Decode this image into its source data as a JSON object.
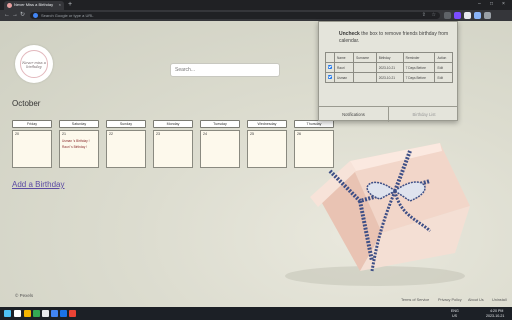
{
  "browser": {
    "tab_title": "Never Miss a Birthday",
    "tab_close": "×",
    "new_tab": "+",
    "omnibox_placeholder": "Search Google or type a URL",
    "back": "←",
    "forward": "→",
    "reload": "↻",
    "minimize": "–",
    "maximize": "□",
    "close": "×",
    "share": "⇪",
    "star": "☆",
    "extension_icon_colors": [
      "#5f6368",
      "#7c4dff",
      "#e8eaed",
      "#8ab4f8",
      "#9aa0a6"
    ]
  },
  "page": {
    "logo_text": "Never miss a birthday",
    "search_placeholder": "Search...",
    "month": "October",
    "days": [
      {
        "label": "Friday",
        "num": "20",
        "events": []
      },
      {
        "label": "Saturday",
        "num": "21",
        "events": [
          "Usman 's Birthday !",
          "Rauri 's Birthday !"
        ]
      },
      {
        "label": "Sunday",
        "num": "22",
        "events": []
      },
      {
        "label": "Monday",
        "num": "23",
        "events": []
      },
      {
        "label": "Tuesday",
        "num": "24",
        "events": []
      },
      {
        "label": "Wednesday",
        "num": "25",
        "events": []
      },
      {
        "label": "Thursday",
        "num": "26",
        "events": []
      }
    ],
    "add_birthday": "Add a Birthday",
    "credit": "© Pexels",
    "footer_links": [
      "Terms of Service",
      "Privacy Policy",
      "About Us",
      "Uninstall"
    ]
  },
  "popup": {
    "note_bold": "Uncheck",
    "note_rest": " the box to remove friends birthday from calendar.",
    "columns": [
      "",
      "Name",
      "Surname",
      "Birthday",
      "Reminder",
      "Action"
    ],
    "rows": [
      {
        "checked": true,
        "name": "Rauri",
        "surname": "",
        "birthday": "2023-10-21",
        "reminder": "7 Days Before",
        "action": "Edit"
      },
      {
        "checked": true,
        "name": "Usman",
        "surname": "",
        "birthday": "2023-10-21",
        "reminder": "7 Days Before",
        "action": "Edit"
      }
    ],
    "notifications_label": "Notifications",
    "birthday_list_label": "Birthday List"
  },
  "taskbar": {
    "lang": "ENG",
    "region": "US",
    "time": "4:20 PM",
    "date": "2023-10-21",
    "icon_colors": [
      "#4fc3f7",
      "#ffffff",
      "#f4b400",
      "#34a853",
      "#e8eaed",
      "#4285f4",
      "#1a73e8",
      "#ea4335",
      "#a142f4"
    ]
  }
}
